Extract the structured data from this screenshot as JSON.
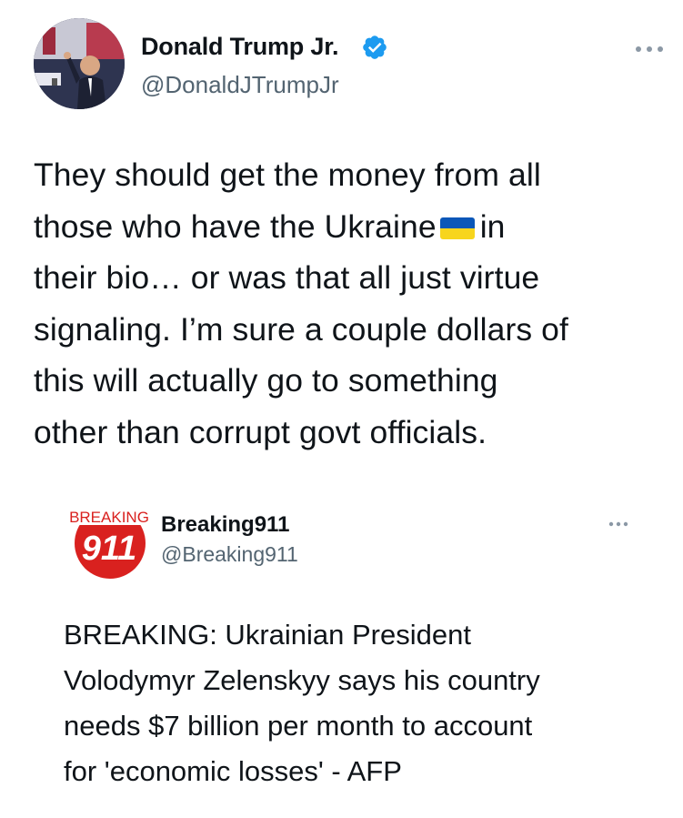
{
  "tweet": {
    "author": {
      "name": "Donald Trump Jr.",
      "handle": "@DonaldJTrumpJr",
      "verified": true,
      "avatar_icon": "profile-photo"
    },
    "text_lines": [
      "They should get the money from all",
      "those who have the Ukraine",
      "in",
      "their bio… or was that all just virtue",
      "signaling. I’m sure a couple dollars of",
      "this will actually go to something",
      "other than corrupt govt officials."
    ],
    "inline_emoji": "ukraine-flag-icon",
    "more_icon": "more-options-icon"
  },
  "quoted_tweet": {
    "author": {
      "name": "Breaking911",
      "handle": "@Breaking911",
      "avatar_logo_text_top": "BREAKING",
      "avatar_logo_text_main": "911"
    },
    "text_lines": [
      "BREAKING: Ukrainian President",
      "Volodymyr Zelenskyy says his country",
      "needs $7 billion per month to account",
      "for 'economic losses' - AFP"
    ],
    "more_icon": "more-options-icon"
  },
  "colors": {
    "text": "#0f1419",
    "secondary": "#536471",
    "verified_blue": "#1d9bf0",
    "flag_blue": "#0b57b8",
    "flag_yellow": "#f7d51d",
    "logo_red": "#d9211f"
  }
}
